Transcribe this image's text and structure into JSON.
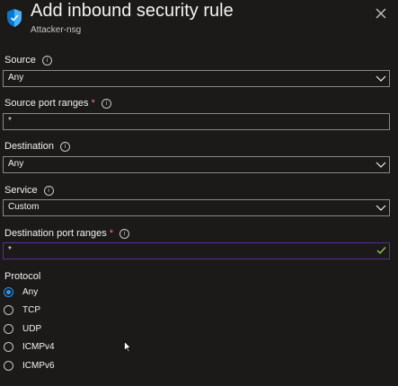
{
  "header": {
    "title": "Add inbound security rule",
    "subtitle": "Attacker-nsg",
    "icon": "shield-icon",
    "close_icon": "close-icon"
  },
  "fields": {
    "source": {
      "label": "Source",
      "value": "Any"
    },
    "source_port_ranges": {
      "label": "Source port ranges",
      "required": "*",
      "value": "*"
    },
    "destination": {
      "label": "Destination",
      "value": "Any"
    },
    "service": {
      "label": "Service",
      "value": "Custom"
    },
    "destination_port_ranges": {
      "label": "Destination port ranges",
      "required": "*",
      "value": "*"
    }
  },
  "protocol": {
    "label": "Protocol",
    "options": [
      "Any",
      "TCP",
      "UDP",
      "ICMPv4",
      "ICMPv6"
    ],
    "selected": "Any"
  },
  "colors": {
    "background": "#1b1a19",
    "accent": "#2899f5",
    "valid": "#5c2e91",
    "check": "#92c353",
    "required": "#f1707b"
  }
}
